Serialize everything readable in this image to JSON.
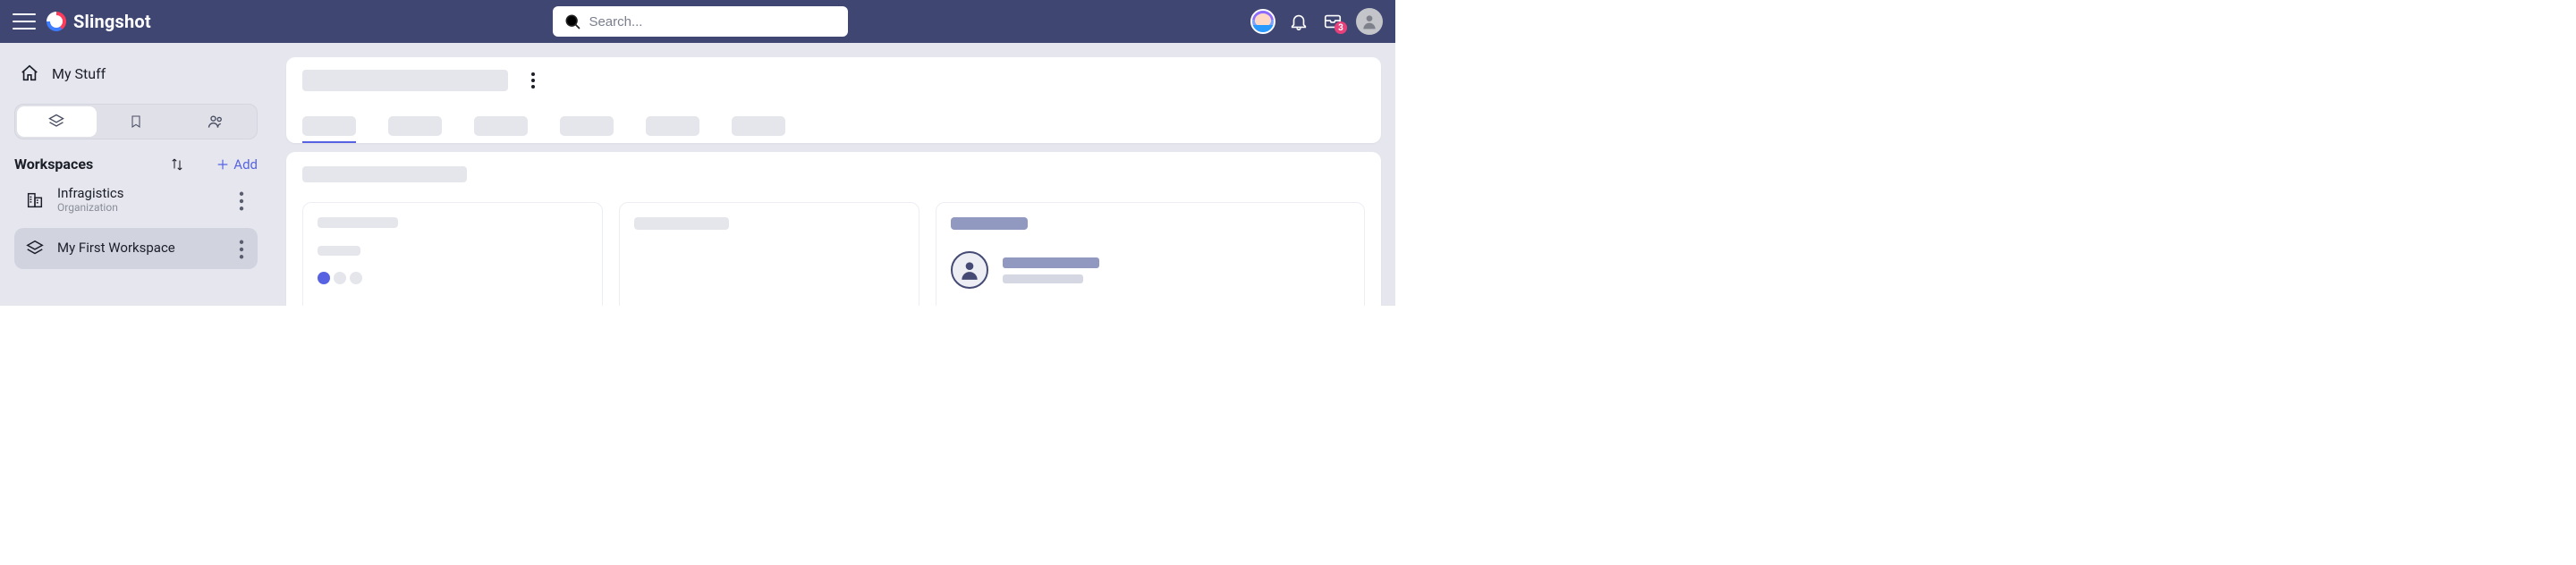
{
  "app_name": "Slingshot",
  "search": {
    "placeholder": "Search..."
  },
  "notifications": {
    "unread_count": "3"
  },
  "sidebar": {
    "my_stuff_label": "My Stuff",
    "section_title": "Workspaces",
    "add_label": "Add",
    "items": [
      {
        "name": "Infragistics",
        "subtitle": "Organization",
        "icon": "building-icon"
      },
      {
        "name": "My First Workspace",
        "subtitle": "",
        "icon": "stack-icon"
      }
    ]
  }
}
